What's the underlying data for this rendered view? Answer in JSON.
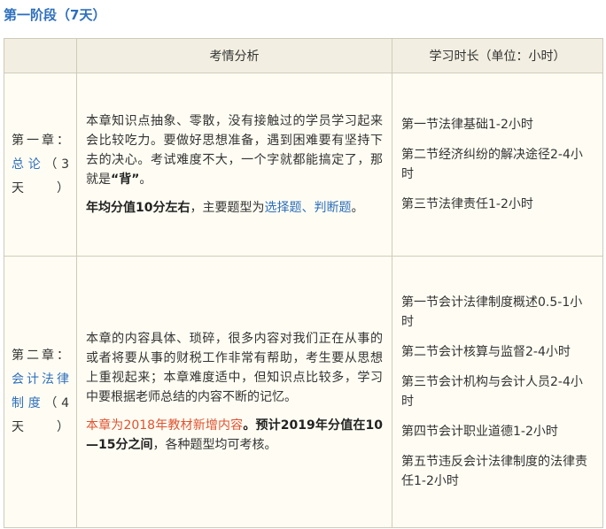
{
  "stage_title": "第一阶段（7天）",
  "headers": {
    "col1": "",
    "col2": "考情分析",
    "col3": "学习时长（单位：小时）"
  },
  "rows": [
    {
      "chapter_prefix": "第一章：",
      "chapter_name": "总论",
      "chapter_days": "（3天）",
      "analysis_p1": "本章知识点抽象、零散，没有接触过的学员学习起来会比较吃力。要做好思想准备，遇到困难要有坚持下去的决心。考试难度不大，一个字就都能搞定了，那就是",
      "analysis_p1_bold": "“背”",
      "analysis_p1_end": "。",
      "analysis_p2_bold": "年均分值10分左右",
      "analysis_p2_mid": "，主要题型为",
      "analysis_p2_blue": "选择题、判断题",
      "analysis_p2_end": "。",
      "hours": [
        "第一节法律基础1-2小时",
        "第二节经济纠纷的解决途径2-4小时",
        "第三节法律责任1-2小时"
      ]
    },
    {
      "chapter_prefix": "第二章：",
      "chapter_name": "会计法律制度",
      "chapter_days": "（4天）",
      "analysis_p1": "本章的内容具体、琐碎，很多内容对我们正在从事的或者将要从事的财税工作非常有帮助，考生要从思想上重视起来；本章难度适中，但知识点比较多，学习中要根据老师总结的内容不断的记忆。",
      "analysis_p2_red": "本章为2018年教材新增内容",
      "analysis_p2_sep": "。",
      "analysis_p2_bold": "预计2019年分值在10—15分之间",
      "analysis_p2_end": "，各种题型均可考核。",
      "hours": [
        "第一节会计法律制度概述0.5-1小时",
        "第二节会计核算与监督2-4小时",
        "第三节会计机构与会计人员2-4小时",
        "第四节会计职业道德1-2小时",
        "第五节违反会计法律制度的法律责任1-2小时"
      ]
    }
  ]
}
